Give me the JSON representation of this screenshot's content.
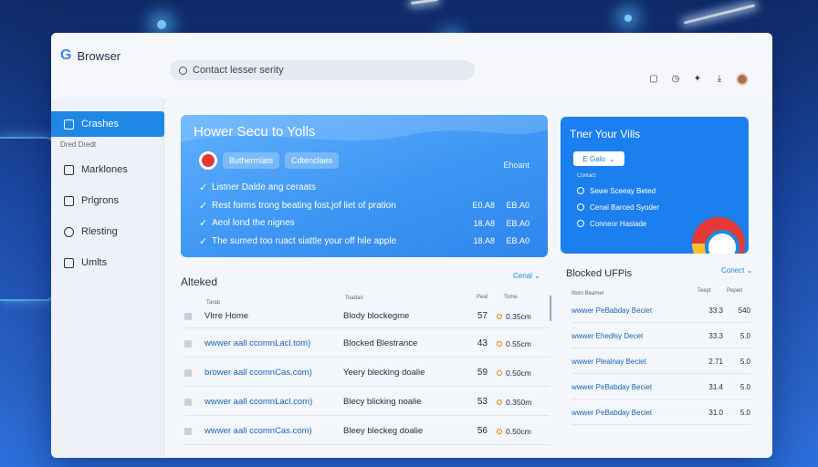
{
  "window": {
    "app_name": "Browser"
  },
  "search": {
    "text": "Contact lesser serity"
  },
  "toolbar": {
    "icons": [
      "bookmark-icon",
      "clock-icon",
      "twitter-icon",
      "download-icon",
      "avatar"
    ]
  },
  "sidebar": {
    "sub_label": "Dred Dredt",
    "items": [
      {
        "label": "Crashes",
        "icon": "shield-icon",
        "active": true
      },
      {
        "label": "Marklones",
        "icon": "camera-icon",
        "active": false
      },
      {
        "label": "Prlgrons",
        "icon": "package-icon",
        "active": false
      },
      {
        "label": "Rlesting",
        "icon": "bell-icon",
        "active": false
      },
      {
        "label": "Umlts",
        "icon": "lock-icon",
        "active": false
      }
    ]
  },
  "hero": {
    "title": "Hower Secu to Yolls",
    "chip1": "Buthermlats",
    "chip2": "Cdtenclaes",
    "tag": "Ehoant",
    "rows": [
      {
        "text": "Listner Dalde ang ceraats",
        "v1": "",
        "v2": ""
      },
      {
        "text": "Rest forms trong beating fost,jof liet of pration",
        "v1": "E0.A8",
        "v2": "EB.A0"
      },
      {
        "text": "Aeol lond the nignes",
        "v1": "18.A8",
        "v2": "EB.A0"
      },
      {
        "text": "The sumed too ruact siattle your off hile apple",
        "v1": "18.A8",
        "v2": "EB.A0"
      }
    ]
  },
  "rcard": {
    "title": "Tner Your Vills",
    "dropdown": "E Galo",
    "sub": "Contact",
    "options": [
      "Sewe Sceeay Beted",
      "Cenal Barced Syoder",
      "Conneor Haslade"
    ]
  },
  "blocked_table": {
    "title": "Alteked",
    "link": "Cenal",
    "col_site": "Tarab",
    "col_desc": "Toadan",
    "col_num": "Peal",
    "col_time": "Tome",
    "rows": [
      {
        "site": "Vlrre Home",
        "plain": true,
        "desc": "Blody blockegme",
        "num": "57",
        "time": "0.35cm"
      },
      {
        "site": "wwwer aall ccomnLacl.tom)",
        "plain": false,
        "desc": "Blocked Blestrance",
        "num": "43",
        "time": "0.55cm"
      },
      {
        "site": "brower aall ccomnCas.com)",
        "plain": false,
        "desc": "Yeery blecking doalie",
        "num": "59",
        "time": "0.50cm"
      },
      {
        "site": "wwwer aall ccomnLacl.com)",
        "plain": false,
        "desc": "Blecy blicking noalie",
        "num": "53",
        "time": "0.350m"
      },
      {
        "site": "wwwer aall ccomnCas.com)",
        "plain": false,
        "desc": "Bleey bleckeg doalie",
        "num": "56",
        "time": "0.50cm"
      }
    ]
  },
  "urls_table": {
    "title": "Blocked UFPis",
    "link": "Conect",
    "col_site": "Itlom Beamer",
    "col_n1": "Teept",
    "col_n2": "Pepiet",
    "rows": [
      {
        "site": "wwwer PeBabday Beciet",
        "n1": "33.3",
        "n2": "540"
      },
      {
        "site": "wwwer Ehedlsy Decet",
        "n1": "33.3",
        "n2": "5.0"
      },
      {
        "site": "wwwer Plealnay Beciet",
        "n1": "2.71",
        "n2": "5.0"
      },
      {
        "site": "wwwer PeBabday Beciet",
        "n1": "31.4",
        "n2": "5.0"
      },
      {
        "site": "wwwer PeBabday Beciet",
        "n1": "31.0",
        "n2": "5.0"
      }
    ]
  },
  "colors": {
    "accent": "#1e88e5",
    "hero": "#3d96f3",
    "card": "#1c7ff0",
    "brand_red": "#e53935"
  }
}
